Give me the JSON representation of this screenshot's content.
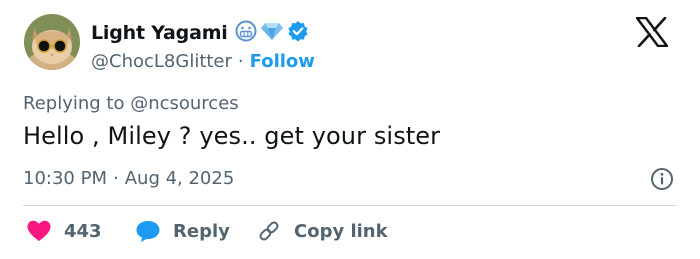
{
  "author": {
    "display_name": "Light Yagami",
    "handle": "@ChocL8Glitter",
    "separator": "·",
    "follow_label": "Follow"
  },
  "post": {
    "replying_prefix": "Replying to ",
    "replying_to": "@ncsources",
    "text": "Hello , Miley ? yes.. get your sister",
    "time": "10:30 PM",
    "time_sep": "·",
    "date": "Aug 4, 2025"
  },
  "actions": {
    "like_count": "443",
    "reply_label": "Reply",
    "copy_link_label": "Copy link"
  },
  "icons": {
    "avatar": "cat-with-sunglasses-avatar",
    "badges": [
      "grimacing-face-emoji",
      "gem-emoji",
      "verified-badge-icon"
    ],
    "brand": "x-logo",
    "info": "info-icon",
    "like": "heart-icon",
    "reply": "speech-bubble-icon",
    "copy": "link-icon"
  },
  "colors": {
    "accent": "#1d9bf0",
    "like": "#f91880",
    "muted_text": "#536471",
    "text": "#0f1419",
    "divider": "#cfd9de"
  }
}
